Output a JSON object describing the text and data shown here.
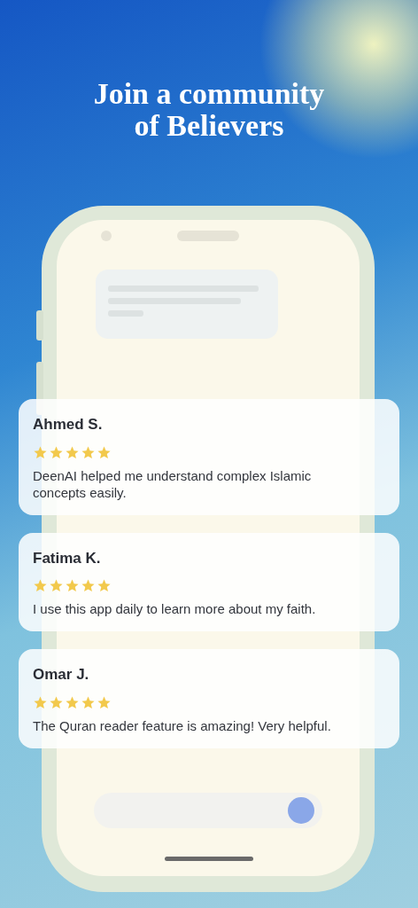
{
  "headline": {
    "line_1": "Join a community",
    "line_2": "of Believers"
  },
  "reviews": [
    {
      "name": "Ahmed S.",
      "stars": 5,
      "text": "DeenAI helped me understand complex Islamic concepts easily."
    },
    {
      "name": "Fatima K.",
      "stars": 5,
      "text": "I use this app daily to learn more about my faith."
    },
    {
      "name": "Omar J.",
      "stars": 5,
      "text": "The Quran reader feature is amazing! Very helpful."
    }
  ]
}
